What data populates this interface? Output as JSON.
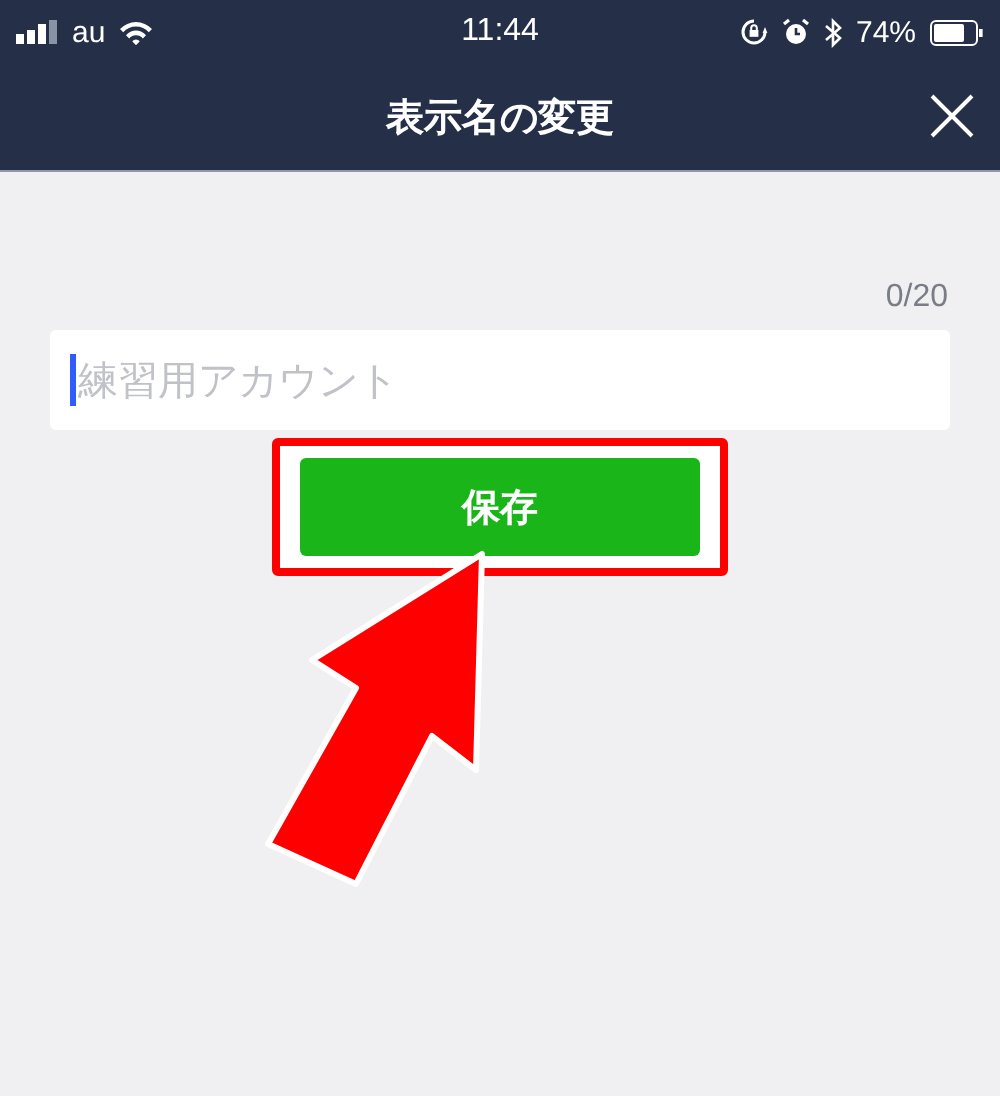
{
  "status_bar": {
    "carrier": "au",
    "time": "11:44",
    "battery": "74%"
  },
  "header": {
    "title": "表示名の変更"
  },
  "name_field": {
    "placeholder": "練習用アカウント",
    "focused": true,
    "counter": "0/20"
  },
  "save_button": {
    "label": "保存"
  }
}
